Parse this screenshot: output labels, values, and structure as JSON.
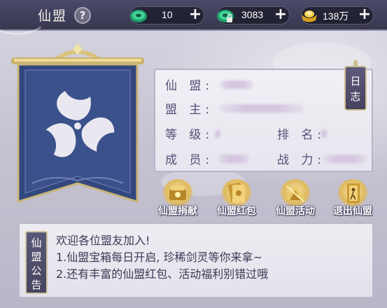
{
  "header": {
    "title": "仙盟",
    "help_label": "?"
  },
  "resources": [
    {
      "icon": "jade-icon",
      "value": "10",
      "plus": "+"
    },
    {
      "icon": "bound-jade-icon",
      "value": "3083",
      "plus": "+"
    },
    {
      "icon": "gold-ingot-icon",
      "value": "138万",
      "plus": "+"
    }
  ],
  "alliance_info": {
    "name_label": "仙 盟:",
    "leader_label": "盟 主:",
    "level_label": "等 级:",
    "rank_label": "排 名:",
    "members_label": "成 员:",
    "power_label": "战 力:"
  },
  "log_button": {
    "label_line1": "日",
    "label_line2": "志"
  },
  "actions": [
    {
      "icon": "donate-icon",
      "label": "仙盟捐献"
    },
    {
      "icon": "red-envelope-icon",
      "label": "仙盟红包"
    },
    {
      "icon": "activity-icon",
      "label": "仙盟活动"
    },
    {
      "icon": "exit-door-icon",
      "label": "退出仙盟"
    }
  ],
  "announcement": {
    "tab_label": [
      "仙",
      "盟",
      "公",
      "告"
    ],
    "lines": [
      "欢迎各位盟友加入!",
      "1.仙盟宝箱每日开启, 珍稀剑灵等你来拿~",
      "2.还有丰富的仙盟红包、活动福利别错过哦"
    ]
  },
  "colors": {
    "banner_blue": "#33477e",
    "gold_trim": "#d8c27e",
    "label_purple": "#54507a"
  }
}
